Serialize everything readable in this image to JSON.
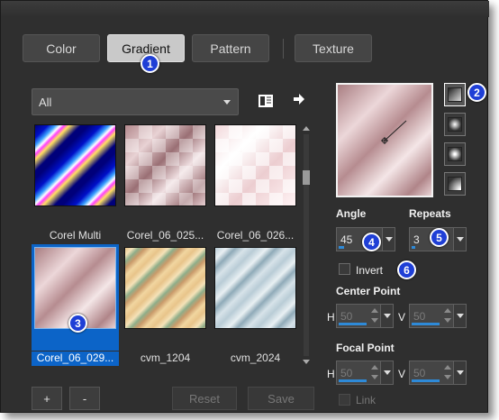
{
  "tabs": [
    {
      "label": "Color",
      "active": false
    },
    {
      "label": "Gradient",
      "active": true
    },
    {
      "label": "Pattern",
      "active": false
    },
    {
      "label": "Texture",
      "active": false
    }
  ],
  "badges": [
    "1",
    "2",
    "3",
    "4",
    "5",
    "6"
  ],
  "category_select": {
    "value": "All"
  },
  "icons": {
    "library": "library-icon",
    "arrow": "arrow-right-icon",
    "scroll_up": "chevron-up-icon",
    "scroll_down": "chevron-down-icon"
  },
  "gradients": [
    {
      "label": "Corel Multi",
      "selected": false
    },
    {
      "label": "Corel_06_025...",
      "selected": false
    },
    {
      "label": "Corel_06_026...",
      "selected": false
    },
    {
      "label": "Corel_06_029...",
      "selected": true
    },
    {
      "label": "cvm_1204",
      "selected": false
    },
    {
      "label": "cvm_2024",
      "selected": false
    }
  ],
  "angle": {
    "label": "Angle",
    "value": "45",
    "fraction": 0.125
  },
  "repeats": {
    "label": "Repeats",
    "value": "3",
    "fraction": 0.03
  },
  "invert": {
    "label": "Invert",
    "checked": false
  },
  "center_point": {
    "label": "Center Point",
    "h_label": "H",
    "h_value": "50",
    "v_label": "V",
    "v_value": "50"
  },
  "focal_point": {
    "label": "Focal Point",
    "h_label": "H",
    "h_value": "50",
    "v_label": "V",
    "v_value": "50"
  },
  "link": {
    "label": "Link",
    "checked": false
  },
  "buttons": {
    "add": "+",
    "remove": "-",
    "reset": "Reset",
    "save": "Save"
  },
  "colors": {
    "accent": "#0c64c8",
    "badge": "#1f3fd6",
    "panel": "#2f2f2f"
  }
}
